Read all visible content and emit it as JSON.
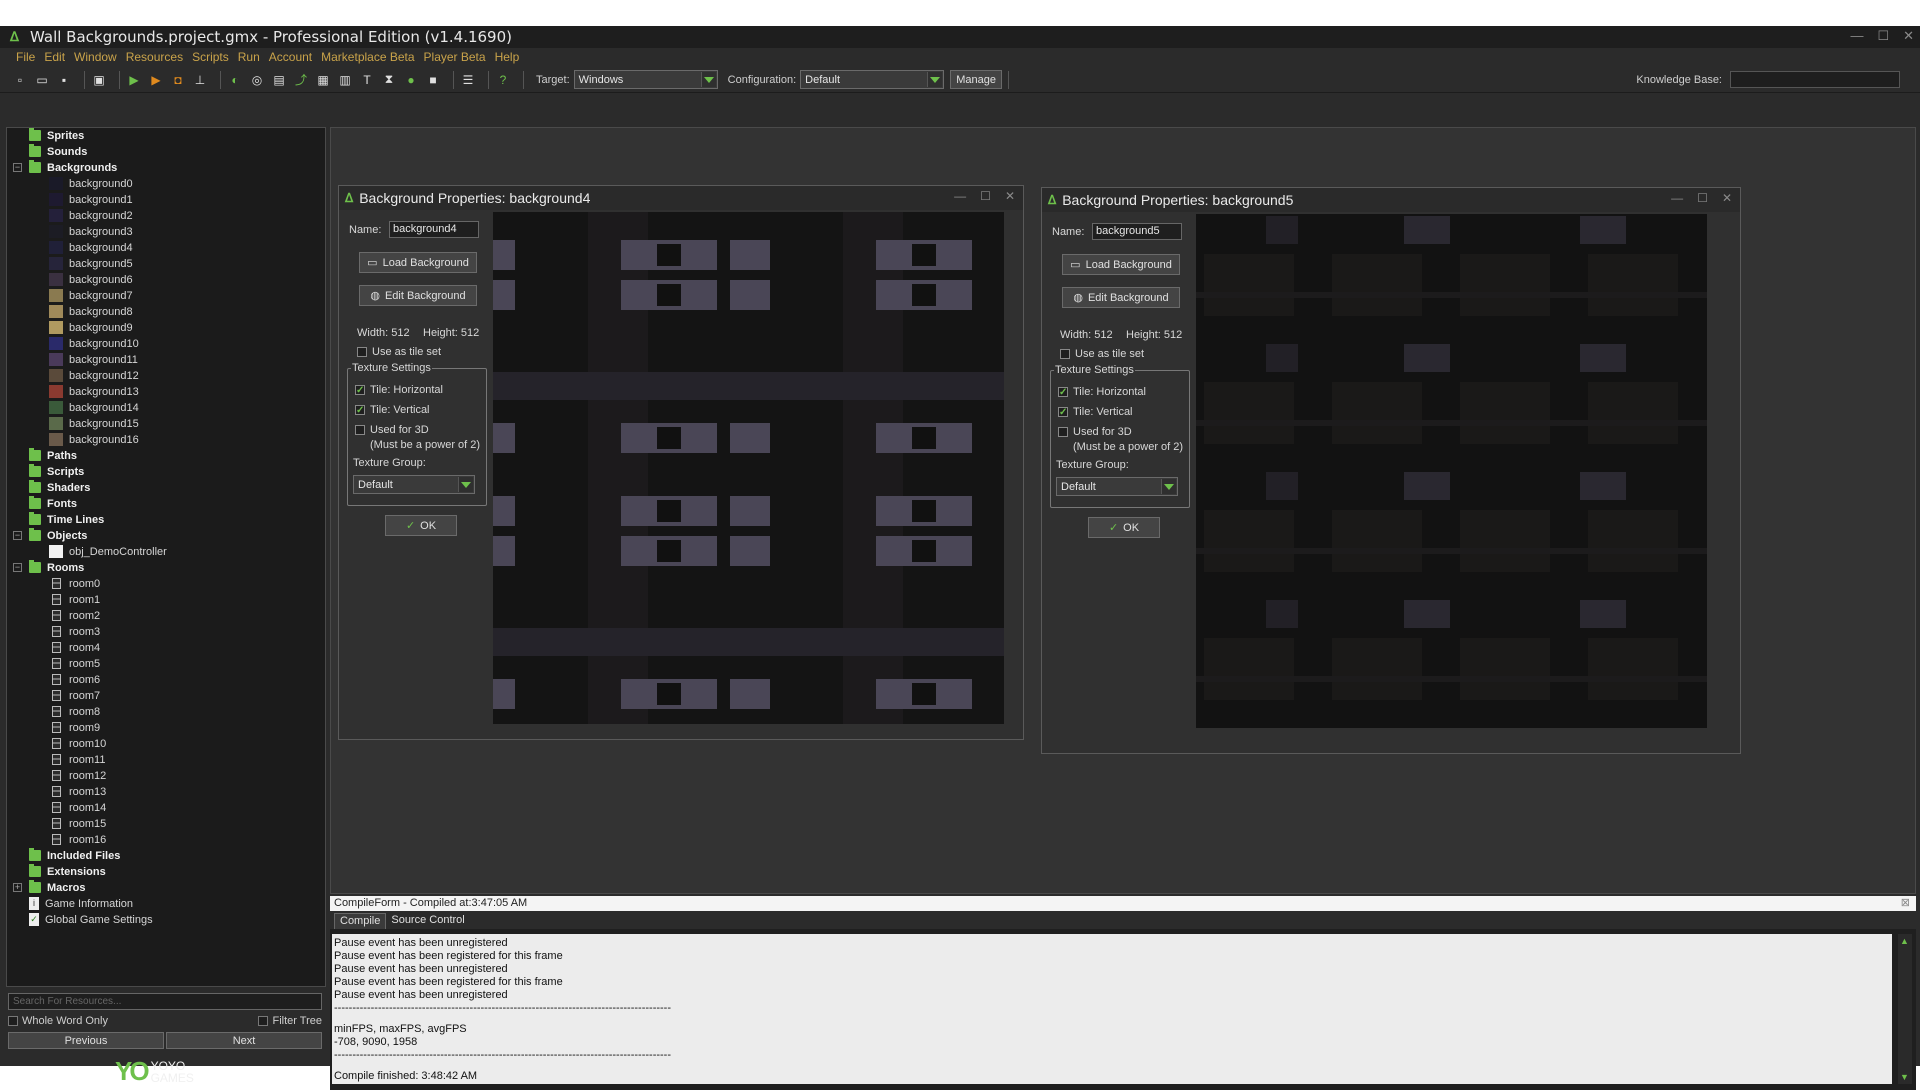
{
  "window": {
    "title": "Wall Backgrounds.project.gmx  -  Professional Edition (v1.4.1690)"
  },
  "menu": [
    "File",
    "Edit",
    "Window",
    "Resources",
    "Scripts",
    "Run",
    "Account",
    "Marketplace Beta",
    "Player Beta",
    "Help"
  ],
  "toolbar": {
    "target_label": "Target:",
    "target_value": "Windows",
    "config_label": "Configuration:",
    "config_value": "Default",
    "manage_label": "Manage",
    "kb_label": "Knowledge Base:"
  },
  "tree": {
    "sprites": "Sprites",
    "sounds": "Sounds",
    "backgrounds": "Backgrounds",
    "bg_items": [
      "background0",
      "background1",
      "background2",
      "background3",
      "background4",
      "background5",
      "background6",
      "background7",
      "background8",
      "background9",
      "background10",
      "background11",
      "background12",
      "background13",
      "background14",
      "background15",
      "background16"
    ],
    "paths": "Paths",
    "scripts": "Scripts",
    "shaders": "Shaders",
    "fonts": "Fonts",
    "timelines": "Time Lines",
    "objects": "Objects",
    "obj_item": "obj_DemoController",
    "rooms": "Rooms",
    "room_items": [
      "room0",
      "room1",
      "room2",
      "room3",
      "room4",
      "room5",
      "room6",
      "room7",
      "room8",
      "room9",
      "room10",
      "room11",
      "room12",
      "room13",
      "room14",
      "room15",
      "room16"
    ],
    "included": "Included Files",
    "extensions": "Extensions",
    "macros": "Macros",
    "game_info": "Game Information",
    "global_settings": "Global Game Settings"
  },
  "left_bottom": {
    "search_placeholder": "Search For Resources...",
    "whole_word": "Whole Word Only",
    "filter_tree": "Filter Tree",
    "previous": "Previous",
    "next": "Next",
    "logo_text1": "YOYO",
    "logo_text2": "GAMES"
  },
  "bg4": {
    "title": "Background Properties: background4",
    "name_label": "Name:",
    "name_value": "background4",
    "load": "Load Background",
    "edit": "Edit Background",
    "width": "Width: 512",
    "height": "Height: 512",
    "tileset": "Use as tile set",
    "texture": "Texture Settings",
    "tile_h": "Tile: Horizontal",
    "tile_v": "Tile: Vertical",
    "used3d": "Used for 3D",
    "pow2": "(Must be a power of 2)",
    "group_label": "Texture Group:",
    "group_value": "Default",
    "ok": "OK"
  },
  "bg5": {
    "title": "Background Properties: background5",
    "name_label": "Name:",
    "name_value": "background5",
    "load": "Load Background",
    "edit": "Edit Background",
    "width": "Width: 512",
    "height": "Height: 512",
    "tileset": "Use as tile set",
    "texture": "Texture Settings",
    "tile_h": "Tile: Horizontal",
    "tile_v": "Tile: Vertical",
    "used3d": "Used for 3D",
    "pow2": "(Must be a power of 2)",
    "group_label": "Texture Group:",
    "group_value": "Default",
    "ok": "OK"
  },
  "compile": {
    "header": "CompileForm - Compiled at:3:47:05 AM",
    "tab_compile": "Compile",
    "tab_source": "Source Control",
    "lines": [
      "Pause event has been unregistered",
      "Pause event has been registered for this frame",
      "Pause event has been unregistered",
      "Pause event has been registered for this frame",
      "Pause event has been unregistered",
      "--------------------------------------------------------------------------------------------",
      "minFPS, maxFPS, avgFPS",
      "-708, 9090, 1958",
      "--------------------------------------------------------------------------------------------",
      "Compile finished: 3:48:42 AM"
    ]
  },
  "colors": {
    "accent": "#6ec04b",
    "menu": "#c9a34a",
    "panel": "#303030"
  },
  "icons": [
    "new-icon",
    "open-icon",
    "save-icon",
    "run-icon",
    "debug-icon",
    "stop-icon",
    "clean-icon",
    "help-icon"
  ]
}
